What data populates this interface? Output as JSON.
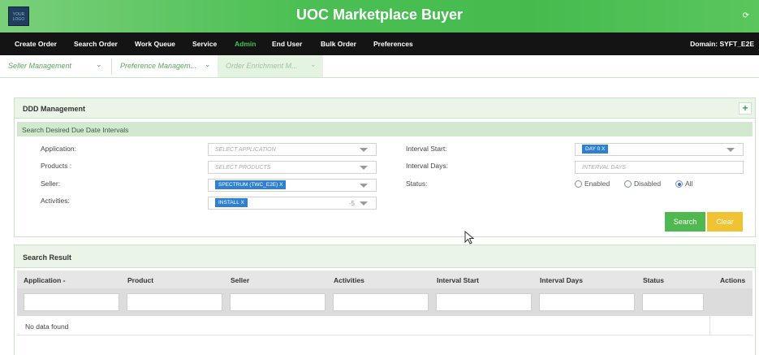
{
  "header": {
    "logo_text": "YOUR LOGO",
    "title": "UOC Marketplace Buyer",
    "logout_glyph": "⟳"
  },
  "nav": {
    "items": [
      {
        "label": "Create Order"
      },
      {
        "label": "Search Order"
      },
      {
        "label": "Work Queue"
      },
      {
        "label": "Service"
      },
      {
        "label": "Admin",
        "active": true
      },
      {
        "label": "End User"
      },
      {
        "label": "Bulk Order"
      },
      {
        "label": "Preferences"
      }
    ],
    "domain": "Domain: SYFT_E2E"
  },
  "subtabs": [
    {
      "label": "Seller Management"
    },
    {
      "label": "Preference Managem..."
    },
    {
      "label": "Order Enrichment M...",
      "active": true
    }
  ],
  "ddd_panel": {
    "title": "DDD Management",
    "add_glyph": "+",
    "section_title": "Search Desired Due Date Intervals",
    "fields": {
      "application": {
        "label": "Application:",
        "placeholder": "SELECT APPLICATION"
      },
      "products": {
        "label": "Products :",
        "placeholder": "SELECT PRODUCTS"
      },
      "seller": {
        "label": "Seller:",
        "tag": "SPECTRUM (TWC_E2E) X"
      },
      "activities": {
        "label": "Activities:",
        "tag": "INSTALL X",
        "count": "-5"
      },
      "interval_start": {
        "label": "Interval Start:",
        "tag": "DAY 0 X"
      },
      "interval_days": {
        "label": "Interval Days:",
        "placeholder": "INTERVAL DAYS"
      },
      "status": {
        "label": "Status:",
        "options": [
          {
            "label": "Enabled",
            "selected": false
          },
          {
            "label": "Disabled",
            "selected": false
          },
          {
            "label": "All",
            "selected": true
          }
        ]
      }
    },
    "search_label": "Search",
    "clear_label": "Clear"
  },
  "results_panel": {
    "title": "Search Result",
    "columns": [
      "Application -",
      "Product",
      "Seller",
      "Activities",
      "Interval Start",
      "Interval Days",
      "Status",
      "Actions"
    ],
    "empty_text": "No data found"
  },
  "colors": {
    "brand_green": "#45bb4e",
    "nav_bg": "#141414",
    "active_nav": "#3cc455",
    "tag_blue": "#2f80d0",
    "clear_yellow": "#f1c232"
  }
}
